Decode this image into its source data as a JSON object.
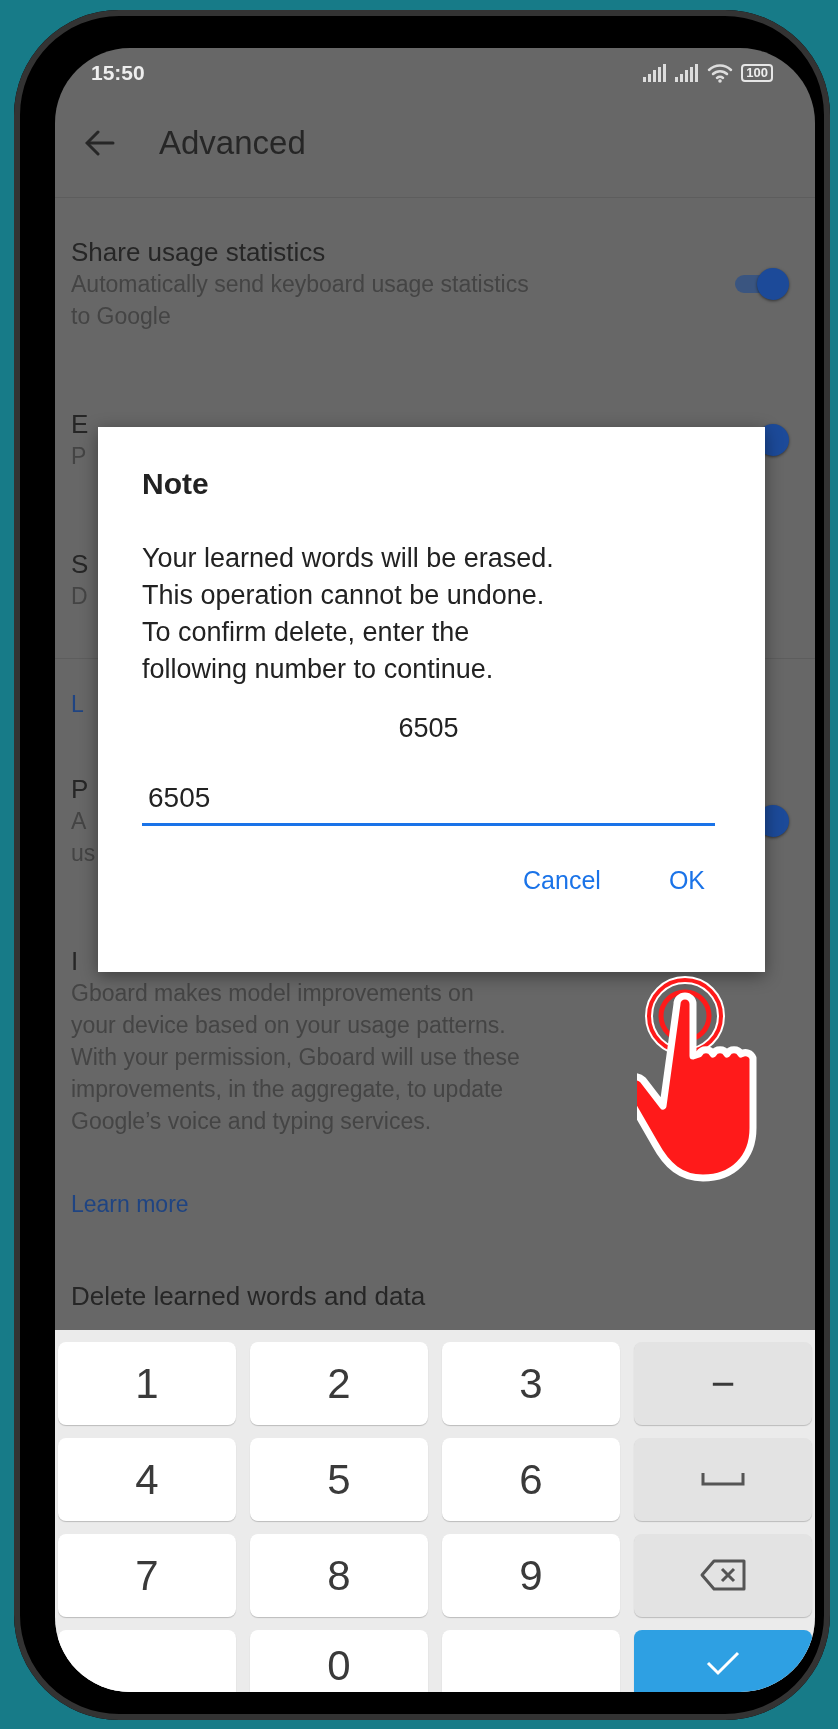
{
  "status_bar": {
    "time": "15:50",
    "battery": "100"
  },
  "app_bar": {
    "title": "Advanced"
  },
  "settings": [
    {
      "kind": "setting",
      "title": "Share usage statistics",
      "summary": [
        "Automatically send keyboard usage statistics",
        "to Google"
      ],
      "toggle": {
        "on": true
      }
    },
    {
      "kind": "setting",
      "title": "E",
      "summary": [
        "P"
      ],
      "toggle": {
        "on": true
      }
    },
    {
      "kind": "setting",
      "title": "S",
      "summary": [
        "D"
      ]
    },
    {
      "kind": "category",
      "title": "L"
    },
    {
      "kind": "setting",
      "title": "P",
      "summary": [
        "A",
        "us"
      ],
      "toggle": {
        "on": true
      }
    },
    {
      "kind": "setting",
      "title": "I",
      "summary": [
        "Gboard makes model improvements on",
        "your device based on your usage patterns.",
        "With your permission, Gboard will use these",
        "improvements, in the aggregate, to update",
        "Google’s voice and typing services."
      ]
    },
    {
      "kind": "link",
      "title": "Learn more"
    },
    {
      "kind": "setting",
      "title": "Delete learned words and data"
    }
  ],
  "dialog": {
    "title": "Note",
    "message": [
      "Your learned words will be erased.",
      "This operation cannot be undone.",
      "To confirm delete, enter the",
      "following number to continue."
    ],
    "code": "6505",
    "input_value": "6505",
    "buttons": [
      "Cancel",
      "OK"
    ]
  },
  "keyboard": [
    {
      "kind": "digit",
      "label": "1"
    },
    {
      "kind": "digit",
      "label": "2"
    },
    {
      "kind": "digit",
      "label": "3"
    },
    {
      "kind": "symbol",
      "label": "−"
    },
    {
      "kind": "digit",
      "label": "4"
    },
    {
      "kind": "digit",
      "label": "5"
    },
    {
      "kind": "digit",
      "label": "6"
    },
    {
      "kind": "space"
    },
    {
      "kind": "digit",
      "label": "7"
    },
    {
      "kind": "digit",
      "label": "8"
    },
    {
      "kind": "digit",
      "label": "9"
    },
    {
      "kind": "backspace"
    },
    {
      "kind": "blank"
    },
    {
      "kind": "digit",
      "label": "0"
    },
    {
      "kind": "blank"
    },
    {
      "kind": "done"
    }
  ]
}
